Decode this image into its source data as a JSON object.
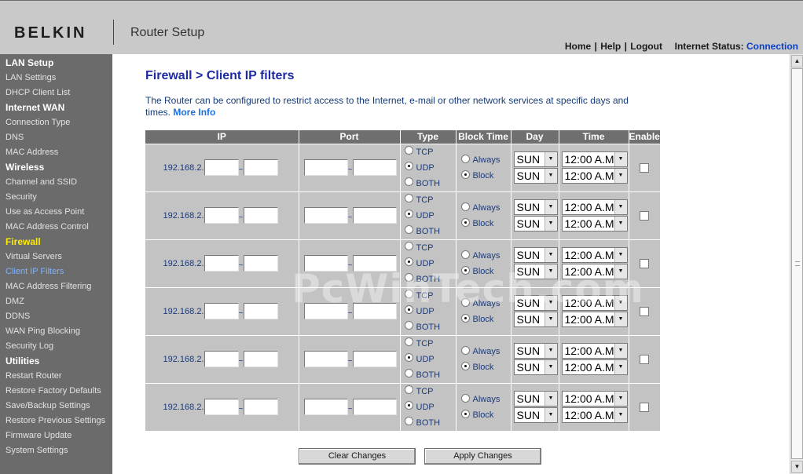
{
  "header": {
    "brand": "BELKIN",
    "app_title": "Router Setup",
    "nav": {
      "home": "Home",
      "help": "Help",
      "logout": "Logout",
      "status_label": "Internet Status:",
      "status_value": "Connection"
    }
  },
  "sidebar": {
    "sections": [
      {
        "title": "LAN Setup",
        "items": [
          "LAN Settings",
          "DHCP Client List"
        ]
      },
      {
        "title": "Internet WAN",
        "items": [
          "Connection Type",
          "DNS",
          "MAC Address"
        ]
      },
      {
        "title": "Wireless",
        "items": [
          "Channel and SSID",
          "Security",
          "Use as Access Point",
          "MAC Address Control"
        ]
      },
      {
        "title": "Firewall",
        "items": [
          "Virtual Servers",
          "Client IP Filters",
          "MAC Address Filtering",
          "DMZ",
          "DDNS",
          "WAN Ping Blocking",
          "Security Log"
        ]
      },
      {
        "title": "Utilities",
        "items": [
          "Restart Router",
          "Restore Factory Defaults",
          "Save/Backup Settings",
          "Restore Previous Settings",
          "Firmware Update",
          "System Settings"
        ]
      }
    ],
    "active_section": "Firewall",
    "active_item": "Client IP Filters"
  },
  "main": {
    "title": "Firewall > Client IP filters",
    "description": "The Router can be configured to restrict access to the Internet, e-mail or other network services at specific days and times.",
    "more_info": "More Info"
  },
  "table": {
    "headers": {
      "ip": "IP",
      "port": "Port",
      "type": "Type",
      "block_time": "Block Time",
      "day": "Day",
      "time": "Time",
      "enable": "Enable"
    },
    "ip_prefix": "192.168.2.",
    "separator": "~",
    "type_options": [
      "TCP",
      "UDP",
      "BOTH"
    ],
    "block_options": [
      "Always",
      "Block"
    ],
    "rows": [
      {
        "ip_start": "",
        "ip_end": "",
        "port_start": "",
        "port_end": "",
        "type": "UDP",
        "block_time": "Block",
        "day_start": "SUN",
        "day_end": "SUN",
        "time_start": "12:00 A.M.",
        "time_end": "12:00 A.M.",
        "enabled": false
      },
      {
        "ip_start": "",
        "ip_end": "",
        "port_start": "",
        "port_end": "",
        "type": "UDP",
        "block_time": "Block",
        "day_start": "SUN",
        "day_end": "SUN",
        "time_start": "12:00 A.M.",
        "time_end": "12:00 A.M.",
        "enabled": false
      },
      {
        "ip_start": "",
        "ip_end": "",
        "port_start": "",
        "port_end": "",
        "type": "UDP",
        "block_time": "Block",
        "day_start": "SUN",
        "day_end": "SUN",
        "time_start": "12:00 A.M.",
        "time_end": "12:00 A.M.",
        "enabled": false
      },
      {
        "ip_start": "",
        "ip_end": "",
        "port_start": "",
        "port_end": "",
        "type": "UDP",
        "block_time": "Block",
        "day_start": "SUN",
        "day_end": "SUN",
        "time_start": "12:00 A.M.",
        "time_end": "12:00 A.M.",
        "enabled": false
      },
      {
        "ip_start": "",
        "ip_end": "",
        "port_start": "",
        "port_end": "",
        "type": "UDP",
        "block_time": "Block",
        "day_start": "SUN",
        "day_end": "SUN",
        "time_start": "12:00 A.M.",
        "time_end": "12:00 A.M.",
        "enabled": false
      },
      {
        "ip_start": "",
        "ip_end": "",
        "port_start": "",
        "port_end": "",
        "type": "UDP",
        "block_time": "Block",
        "day_start": "SUN",
        "day_end": "SUN",
        "time_start": "12:00 A.M.",
        "time_end": "12:00 A.M.",
        "enabled": false
      }
    ]
  },
  "buttons": {
    "clear": "Clear Changes",
    "apply": "Apply Changes"
  },
  "watermark": "PcWinTech.com",
  "colors": {
    "header_bg": "#c9c9c9",
    "sidebar_bg": "#6b6b6b",
    "active_section": "#ffea00",
    "active_item": "#7fb2ff",
    "title": "#1d2ca4",
    "link": "#1e6fe0",
    "table_header_bg": "#6f6f6f",
    "table_cell_bg": "#c3c3c3"
  },
  "icons": {
    "select_arrow": "chevron-down-icon",
    "scroll_up": "arrow-up-icon",
    "scroll_down": "arrow-down-icon"
  }
}
